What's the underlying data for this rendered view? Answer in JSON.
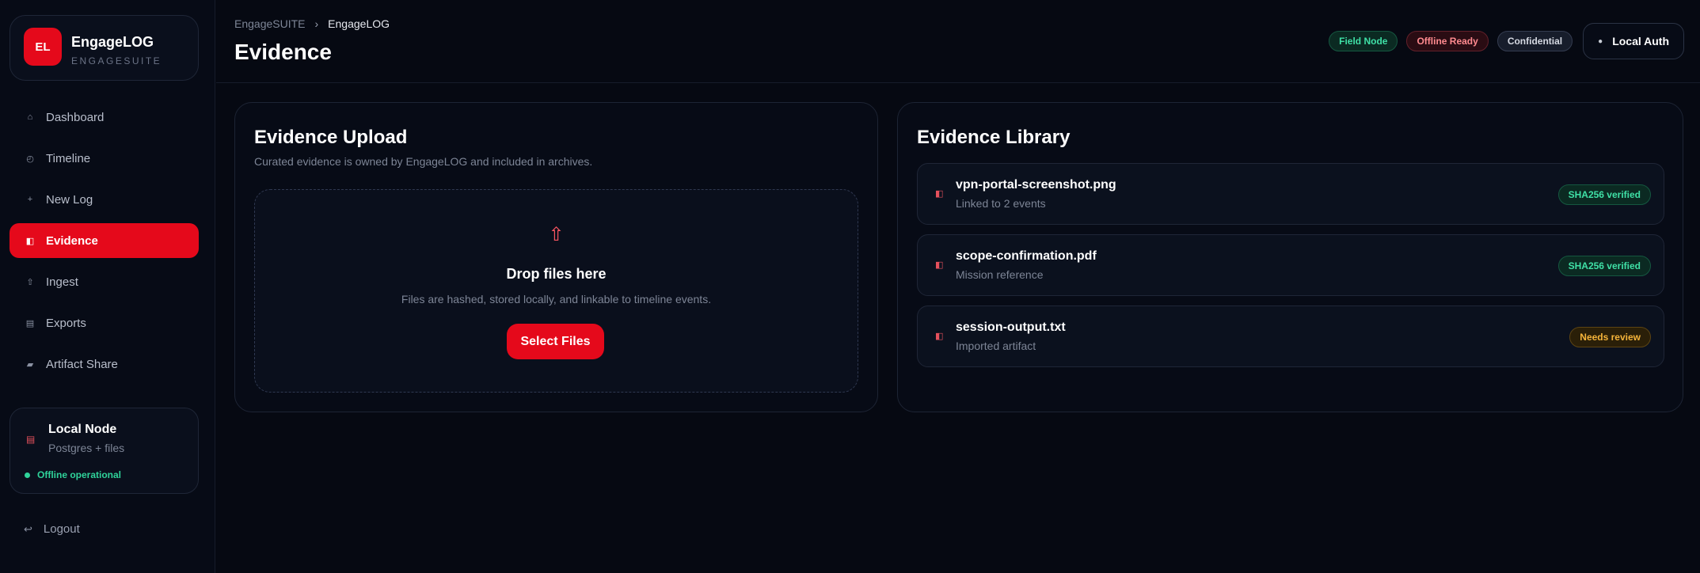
{
  "sidebar": {
    "brand": {
      "logo": "EL",
      "name": "EngageLOG",
      "sub": "ENGAGESUITE"
    },
    "nav": [
      {
        "label": "Dashboard",
        "icon": "⌂",
        "icon_name": "home-icon",
        "active": false
      },
      {
        "label": "Timeline",
        "icon": "◴",
        "icon_name": "clock-icon",
        "active": false
      },
      {
        "label": "New Log",
        "icon": "+",
        "icon_name": "plus-icon",
        "active": false
      },
      {
        "label": "Evidence",
        "icon": "◧",
        "icon_name": "evidence-icon",
        "active": true
      },
      {
        "label": "Ingest",
        "icon": "⇧",
        "icon_name": "upload-icon",
        "active": false
      },
      {
        "label": "Exports",
        "icon": "▤",
        "icon_name": "export-icon",
        "active": false
      },
      {
        "label": "Artifact Share",
        "icon": "▰",
        "icon_name": "share-icon",
        "active": false
      }
    ],
    "node": {
      "icon": "▤",
      "title": "Local Node",
      "sub": "Postgres + files",
      "status": "Offline operational"
    },
    "logout": {
      "icon": "↩",
      "label": "Logout"
    }
  },
  "header": {
    "breadcrumb": [
      "EngageSUITE",
      "EngageLOG"
    ],
    "breadcrumb_sep": "›",
    "title": "Evidence",
    "badges": [
      {
        "label": "Field Node",
        "tone": "green"
      },
      {
        "label": "Offline Ready",
        "tone": "red"
      },
      {
        "label": "Confidential",
        "tone": "gray"
      }
    ],
    "auth": {
      "icon": "●",
      "label": "Local Auth"
    }
  },
  "upload": {
    "title": "Evidence Upload",
    "subtitle": "Curated evidence is owned by EngageLOG and included in archives.",
    "drop_icon": "⇧",
    "drop_title": "Drop files here",
    "drop_sub": "Files are hashed, stored locally, and linkable to timeline events.",
    "button": "Select Files"
  },
  "library": {
    "title": "Evidence Library",
    "files": [
      {
        "name": "vpn-portal-screenshot.png",
        "sub": "Linked to 2 events",
        "badge": "SHA256 verified",
        "tone": "ok"
      },
      {
        "name": "scope-confirmation.pdf",
        "sub": "Mission reference",
        "badge": "SHA256 verified",
        "tone": "ok"
      },
      {
        "name": "session-output.txt",
        "sub": "Imported artifact",
        "badge": "Needs review",
        "tone": "warn"
      }
    ]
  },
  "colors": {
    "accent": "#e5091b",
    "background": "#060912",
    "ok": "#3fe0a6",
    "warn": "#f5b43a"
  }
}
